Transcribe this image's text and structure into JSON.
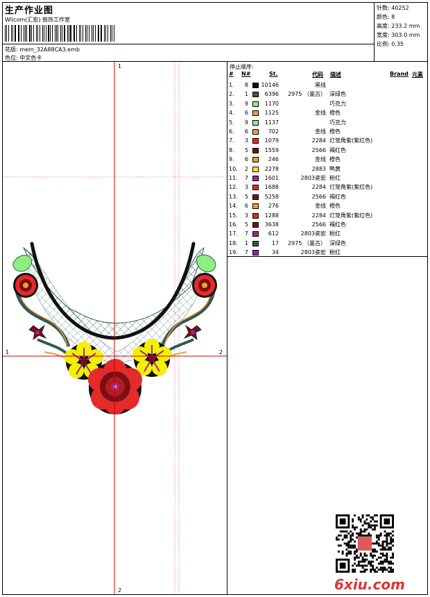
{
  "header": {
    "title": "生产作业图",
    "company": "Wilcom(汇宏) 鼓饰工作室",
    "pattern": "花版:  mem_32A88CA3.emb",
    "colorway": "色位:  中文色卡"
  },
  "stats": [
    {
      "label": "针数:",
      "value": "40252"
    },
    {
      "label": "颜色:",
      "value": "8"
    },
    {
      "label": "高度:",
      "value": "233.2 mm"
    },
    {
      "label": "宽度:",
      "value": "303.0 mm"
    },
    {
      "label": "比例:",
      "value": "0.35"
    }
  ],
  "sequence": {
    "title": "停止顺序:",
    "headers": {
      "idx": "#",
      "n": "N#",
      "st": "St.",
      "code": "代码",
      "desc": "描述",
      "brand": "Brand",
      "element": "元素"
    },
    "rows": [
      {
        "idx": "1.",
        "n": "8",
        "color": "#111111",
        "st": "10146",
        "code": "黑线",
        "desc": ""
      },
      {
        "idx": "2.",
        "n": "1",
        "color": "#2f5a55",
        "st": "6396",
        "code": "2975 （墨古）",
        "desc": "深绿色"
      },
      {
        "idx": "3.",
        "n": "9",
        "color": "#8cf07e",
        "st": "1170",
        "code": "",
        "desc": "巧克力"
      },
      {
        "idx": "4.",
        "n": "6",
        "color": "#f39a3c",
        "st": "1125",
        "code": "金线",
        "desc": "橙色"
      },
      {
        "idx": "5.",
        "n": "9",
        "color": "#8cf07e",
        "st": "1137",
        "code": "",
        "desc": "巧克力"
      },
      {
        "idx": "6.",
        "n": "6",
        "color": "#f39a3c",
        "st": "702",
        "code": "金线",
        "desc": "橙色"
      },
      {
        "idx": "7.",
        "n": "3",
        "color": "#e52a2a",
        "st": "1079",
        "code": "2284",
        "desc": "灯笼角紫(紫红色)"
      },
      {
        "idx": "8.",
        "n": "5",
        "color": "#7a0f16",
        "st": "1559",
        "code": "2566",
        "desc": "褐红色"
      },
      {
        "idx": "9.",
        "n": "6",
        "color": "#f39a3c",
        "st": "246",
        "code": "金线",
        "desc": "橙色"
      },
      {
        "idx": "10.",
        "n": "2",
        "color": "#f5f000",
        "st": "2278",
        "code": "2883",
        "desc": "鸭黄"
      },
      {
        "idx": "11.",
        "n": "7",
        "color": "#9a25a8",
        "st": "1601",
        "code": "2803瓷宏",
        "desc": "粉红"
      },
      {
        "idx": "12.",
        "n": "3",
        "color": "#e52a2a",
        "st": "1688",
        "code": "2284",
        "desc": "灯笼角紫(紫红色)"
      },
      {
        "idx": "13.",
        "n": "5",
        "color": "#7a0f16",
        "st": "5258",
        "code": "2566",
        "desc": "褐红色"
      },
      {
        "idx": "14.",
        "n": "6",
        "color": "#f39a3c",
        "st": "276",
        "code": "金线",
        "desc": "橙色"
      },
      {
        "idx": "15.",
        "n": "3",
        "color": "#e52a2a",
        "st": "1288",
        "code": "2284",
        "desc": "灯笼角紫(紫红色)"
      },
      {
        "idx": "16.",
        "n": "5",
        "color": "#7a0f16",
        "st": "3638",
        "code": "2566",
        "desc": "褐红色"
      },
      {
        "idx": "17.",
        "n": "7",
        "color": "#9a25a8",
        "st": "612",
        "code": "2803瓷宏",
        "desc": "粉红"
      },
      {
        "idx": "18.",
        "n": "1",
        "color": "#2f5a55",
        "st": "17",
        "code": "2975 （墨古）",
        "desc": "深绿色"
      },
      {
        "idx": "19.",
        "n": "7",
        "color": "#9a25a8",
        "st": "34",
        "code": "2803瓷宏",
        "desc": "粉红"
      }
    ]
  },
  "guides": {
    "v1": "1",
    "v2": "2",
    "h1": "1",
    "h2": "2"
  },
  "logo": "6xiu.com",
  "colors": {
    "guide": "#cc0000",
    "dotted": "#cc3399",
    "logo": "#e03436"
  }
}
